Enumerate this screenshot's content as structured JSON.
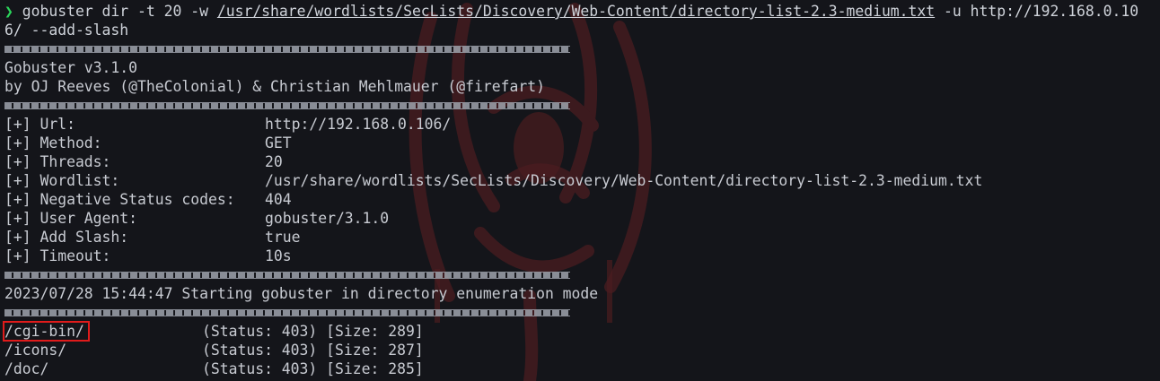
{
  "command": {
    "prompt_symbol": "❯",
    "line1_before_path": " gobuster dir -t 20 -w ",
    "wordlist_path": "/usr/share/wordlists/SecLists/Discovery/Web-Content/directory-list-2.3-medium.txt",
    "line1_after_path": " -u http://192.168.0.10",
    "line2": "6/ --add-slash"
  },
  "banner": {
    "version_line": "Gobuster v3.1.0",
    "author_line": "by OJ Reeves (@TheColonial) & Christian Mehlmauer (@firefart)"
  },
  "config": [
    {
      "label": "[+] Url:",
      "value": "http://192.168.0.106/"
    },
    {
      "label": "[+] Method:",
      "value": "GET"
    },
    {
      "label": "[+] Threads:",
      "value": "20"
    },
    {
      "label": "[+] Wordlist:",
      "value": "/usr/share/wordlists/SecLists/Discovery/Web-Content/directory-list-2.3-medium.txt"
    },
    {
      "label": "[+] Negative Status codes:",
      "value": "404"
    },
    {
      "label": "[+] User Agent:",
      "value": "gobuster/3.1.0"
    },
    {
      "label": "[+] Add Slash:",
      "value": "true"
    },
    {
      "label": "[+] Timeout:",
      "value": "10s"
    }
  ],
  "status_line": "2023/07/28 15:44:47 Starting gobuster in directory enumeration mode",
  "results": [
    {
      "path": "/cgi-bin/",
      "info": "(Status: 403) [Size: 289]"
    },
    {
      "path": "/icons/",
      "info": "(Status: 403) [Size: 287]"
    },
    {
      "path": "/doc/",
      "info": "(Status: 403) [Size: 285]"
    }
  ],
  "colors": {
    "background": "#14151a",
    "text": "#c8cbd2",
    "prompt": "#2bd65b",
    "highlight_box": "#e01b1b"
  }
}
